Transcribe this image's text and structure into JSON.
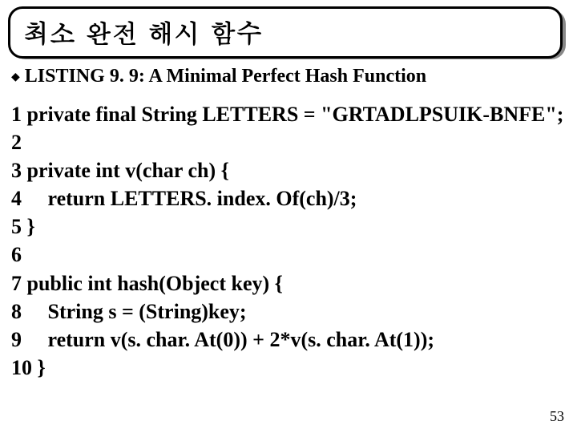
{
  "title": "최소 완전 해시 함수",
  "listing": {
    "bullet": "◆",
    "label": "LISTING 9. 9: A Minimal Perfect Hash Function"
  },
  "code": {
    "l1": "1 private final String LETTERS = \"GRTADLPSUIK-BNFE\";",
    "l2": "2",
    "l3": "3 private int v(char ch) {",
    "l4": "4     return LETTERS. index. Of(ch)/3;",
    "l5": "5 }",
    "l6": "6",
    "l7": "7 public int hash(Object key) {",
    "l8": "8     String s = (String)key;",
    "l9": "9     return v(s. char. At(0)) + 2*v(s. char. At(1));",
    "l10": "10 }"
  },
  "page_number": "53"
}
